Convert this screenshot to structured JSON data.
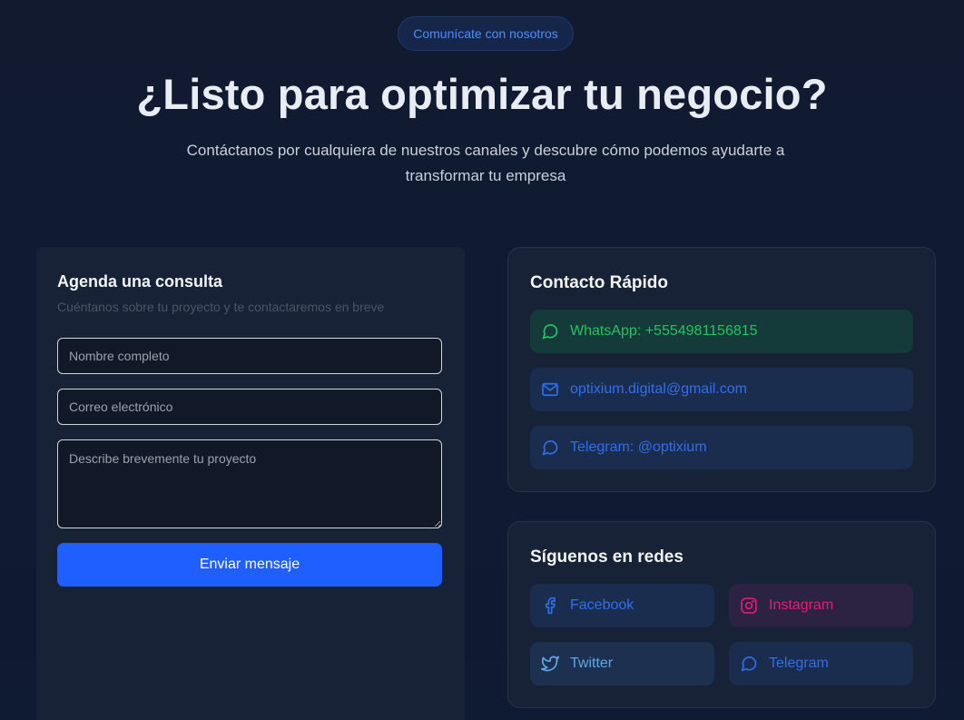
{
  "header": {
    "pill_label": "Comunícate con nosotros",
    "title": "¿Listo para optimizar tu negocio?",
    "subtitle": "Contáctanos por cualquiera de nuestros canales y descubre cómo podemos ayudarte a transformar tu empresa"
  },
  "form": {
    "title": "Agenda una consulta",
    "description": "Cuéntanos sobre tu proyecto y te contactaremos en breve",
    "name_placeholder": "Nombre completo",
    "email_placeholder": "Correo electrónico",
    "message_placeholder": "Describe brevemente tu proyecto",
    "submit_label": "Enviar mensaje"
  },
  "quick_contact": {
    "title": "Contacto Rápido",
    "items": [
      {
        "icon": "whatsapp-icon",
        "label": "WhatsApp: +5554981156815",
        "color": "#22c55e",
        "bg": "#143a3a"
      },
      {
        "icon": "mail-icon",
        "label": "optixium.digital@gmail.com",
        "color": "#2f6fed",
        "bg": "#1b2d4e"
      },
      {
        "icon": "telegram-icon",
        "label": "Telegram: @optixium",
        "color": "#2f6fed",
        "bg": "#1b2d4e"
      }
    ]
  },
  "social": {
    "title": "Síguenos en redes",
    "items": [
      {
        "icon": "facebook-icon",
        "label": "Facebook",
        "color": "#2f6fed",
        "bg": "#1b2d4e"
      },
      {
        "icon": "instagram-icon",
        "label": "Instagram",
        "color": "#e11d74",
        "bg": "#2c2342"
      },
      {
        "icon": "twitter-icon",
        "label": "Twitter",
        "color": "#5fa8e8",
        "bg": "#1e3050"
      },
      {
        "icon": "telegram-icon",
        "label": "Telegram",
        "color": "#2f6fed",
        "bg": "#1b2d4e"
      }
    ]
  }
}
